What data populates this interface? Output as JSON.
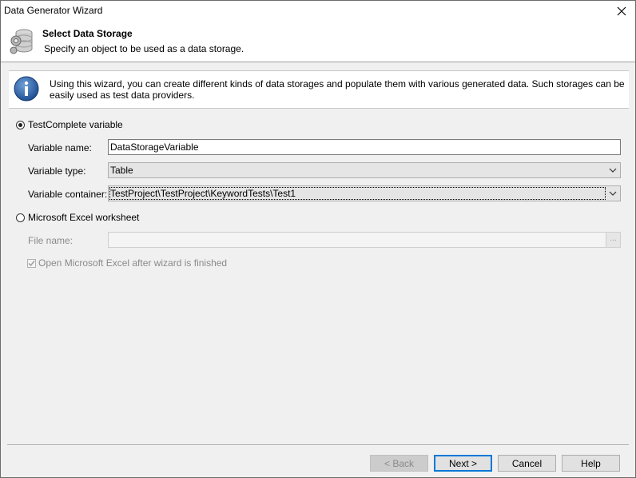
{
  "window": {
    "title": "Data Generator Wizard"
  },
  "header": {
    "title": "Select Data Storage",
    "subtitle": "Specify an object to be used as a data storage."
  },
  "info": {
    "text": "Using this wizard, you can create different kinds of data storages and populate them with various generated data. Such storages can be easily used as test data providers."
  },
  "options": {
    "testcomplete_variable": {
      "label": "TestComplete variable",
      "selected": true,
      "variable_name_label": "Variable name:",
      "variable_name_value": "DataStorageVariable",
      "variable_type_label": "Variable type:",
      "variable_type_value": "Table",
      "variable_container_label": "Variable container:",
      "variable_container_value": "TestProject\\TestProject\\KeywordTests\\Test1"
    },
    "excel_worksheet": {
      "label": "Microsoft Excel worksheet",
      "selected": false,
      "file_name_label": "File name:",
      "file_name_value": "",
      "browse_label": "...",
      "open_excel_label": "Open Microsoft Excel after wizard is finished",
      "open_excel_checked": true
    }
  },
  "buttons": {
    "back": "< Back",
    "next": "Next >",
    "cancel": "Cancel",
    "help": "Help"
  }
}
